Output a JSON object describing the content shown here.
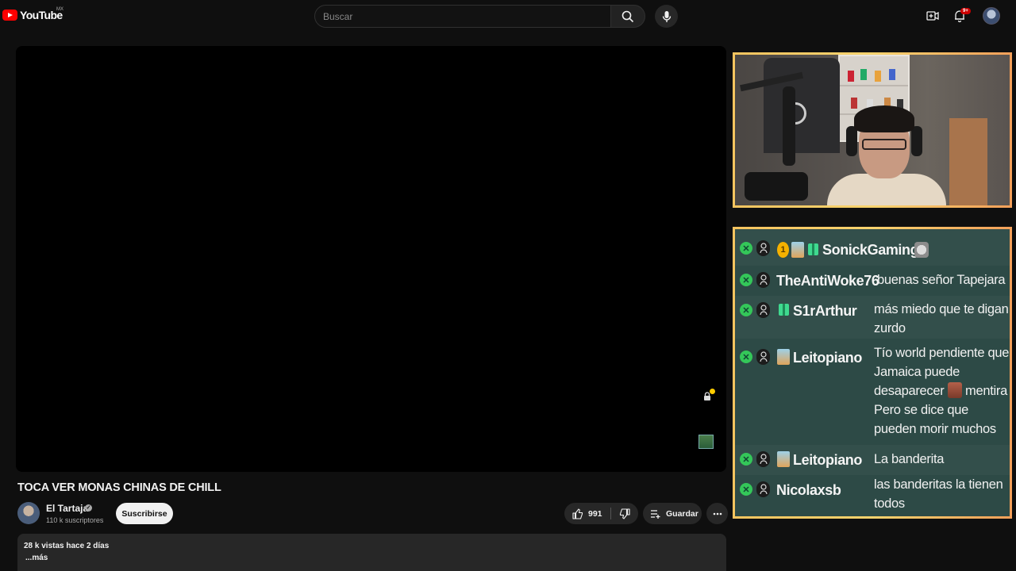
{
  "header": {
    "logo_text": "YouTube",
    "logo_country": "MX",
    "search_placeholder": "Buscar",
    "notification_count": "9+"
  },
  "video": {
    "title": "TOCA VER MONAS CHINAS DE CHILL",
    "channel_name": "El Tartaja",
    "subscribers": "110 k suscriptores",
    "subscribe_label": "Suscribirse",
    "likes": "991",
    "save_label": "Guardar",
    "description_meta": "28 k vistas  hace 2 días",
    "description_more": "...más"
  },
  "chat": {
    "messages": [
      {
        "user": "SonickGaming",
        "text": ""
      },
      {
        "user": "TheAntiWoke76",
        "text": "buenas señor Tapejara"
      },
      {
        "user": "S1rArthur",
        "text": "más miedo que te digan zurdo"
      },
      {
        "user": "Leitopiano",
        "text_before_emote": "Tío world pendiente que Jamaica puede desaparecer",
        "text_after_emote": "mentira Pero se dice que pueden morir muchos"
      },
      {
        "user": "Leitopiano",
        "text": "La banderita"
      },
      {
        "user": "Nicolaxsb",
        "text": "las banderitas la tienen todos"
      }
    ],
    "coin_badge": "1",
    "accent_border": "#f5c45f",
    "background": "#2d4a46"
  },
  "colors": {
    "page_bg": "#0f0f0f",
    "brand_red": "#ff0000",
    "xbox_green": "#34c759"
  }
}
